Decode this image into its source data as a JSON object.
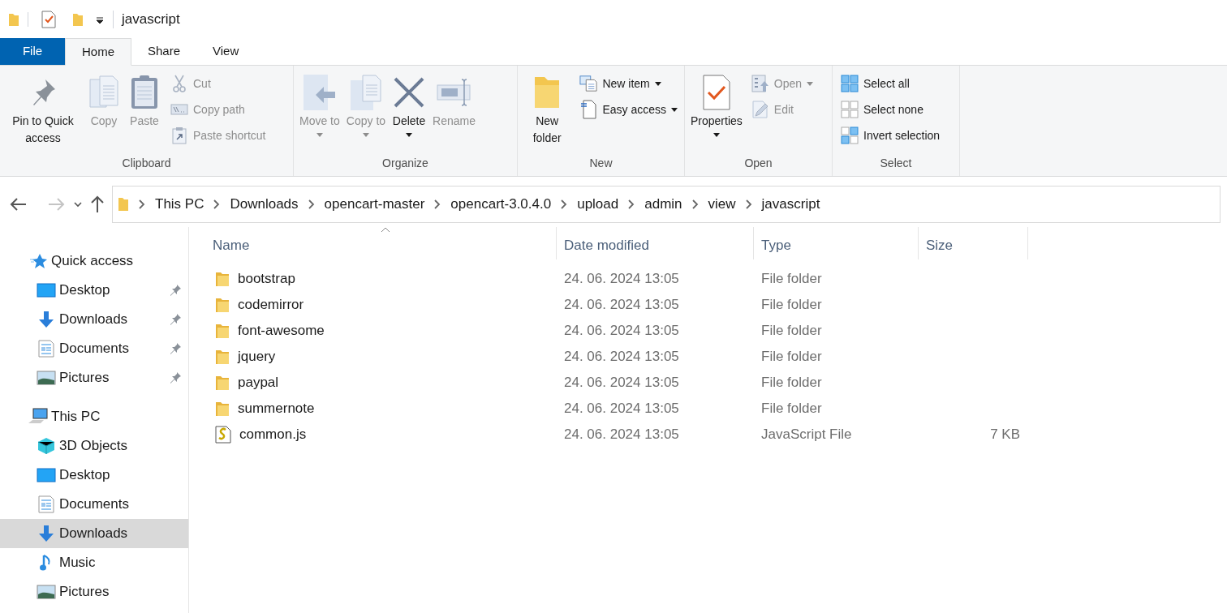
{
  "window": {
    "title": "javascript"
  },
  "tabs": [
    {
      "label": "File",
      "selected": false,
      "kind": "file"
    },
    {
      "label": "Home",
      "selected": true,
      "kind": "tab"
    },
    {
      "label": "Share",
      "selected": false,
      "kind": "tab"
    },
    {
      "label": "View",
      "selected": false,
      "kind": "tab"
    }
  ],
  "ribbon": {
    "groups": [
      {
        "label": "Clipboard",
        "items": [
          {
            "label": "Pin to Quick access",
            "kind": "large",
            "disabled": false,
            "dropdown": false
          },
          {
            "label": "Copy",
            "kind": "large",
            "disabled": true,
            "dropdown": false
          },
          {
            "label": "Paste",
            "kind": "large",
            "disabled": true,
            "dropdown": false
          },
          {
            "label": "Cut",
            "kind": "small",
            "disabled": true,
            "dropdown": false
          },
          {
            "label": "Copy path",
            "kind": "small",
            "disabled": true,
            "dropdown": false
          },
          {
            "label": "Paste shortcut",
            "kind": "small",
            "disabled": true,
            "dropdown": false
          }
        ]
      },
      {
        "label": "Organize",
        "items": [
          {
            "label": "Move to",
            "kind": "large",
            "disabled": true,
            "dropdown": true
          },
          {
            "label": "Copy to",
            "kind": "large",
            "disabled": true,
            "dropdown": true
          },
          {
            "label": "Delete",
            "kind": "large",
            "disabled": false,
            "dropdown": true
          },
          {
            "label": "Rename",
            "kind": "large",
            "disabled": true,
            "dropdown": false
          }
        ]
      },
      {
        "label": "New",
        "items": [
          {
            "label": "New folder",
            "kind": "large",
            "disabled": false,
            "dropdown": false
          },
          {
            "label": "New item",
            "kind": "small",
            "disabled": false,
            "dropdown": true
          },
          {
            "label": "Easy access",
            "kind": "small",
            "disabled": false,
            "dropdown": true
          }
        ]
      },
      {
        "label": "Open",
        "items": [
          {
            "label": "Properties",
            "kind": "large",
            "disabled": false,
            "dropdown": true
          },
          {
            "label": "Open",
            "kind": "small",
            "disabled": true,
            "dropdown": true
          },
          {
            "label": "Edit",
            "kind": "small",
            "disabled": true,
            "dropdown": false
          }
        ]
      },
      {
        "label": "Select",
        "items": [
          {
            "label": "Select all",
            "kind": "small",
            "disabled": false,
            "dropdown": false
          },
          {
            "label": "Select none",
            "kind": "small",
            "disabled": false,
            "dropdown": false
          },
          {
            "label": "Invert selection",
            "kind": "small",
            "disabled": false,
            "dropdown": false
          }
        ]
      }
    ]
  },
  "navigation": {
    "forward_disabled": true,
    "breadcrumb": [
      "This PC",
      "Downloads",
      "opencart-master",
      "opencart-3.0.4.0",
      "upload",
      "admin",
      "view",
      "javascript"
    ]
  },
  "sidebar": {
    "items": [
      {
        "label": "Quick access",
        "kind": "header",
        "pinned": false,
        "selected": false
      },
      {
        "label": "Desktop",
        "kind": "item",
        "pinned": true,
        "selected": false
      },
      {
        "label": "Downloads",
        "kind": "item",
        "pinned": true,
        "selected": false
      },
      {
        "label": "Documents",
        "kind": "item",
        "pinned": true,
        "selected": false
      },
      {
        "label": "Pictures",
        "kind": "item",
        "pinned": true,
        "selected": false
      },
      {
        "label": "This PC",
        "kind": "header",
        "pinned": false,
        "selected": false
      },
      {
        "label": "3D Objects",
        "kind": "item",
        "pinned": false,
        "selected": false
      },
      {
        "label": "Desktop",
        "kind": "item",
        "pinned": false,
        "selected": false
      },
      {
        "label": "Documents",
        "kind": "item",
        "pinned": false,
        "selected": false
      },
      {
        "label": "Downloads",
        "kind": "item",
        "pinned": false,
        "selected": true
      },
      {
        "label": "Music",
        "kind": "item",
        "pinned": false,
        "selected": false
      },
      {
        "label": "Pictures",
        "kind": "item",
        "pinned": false,
        "selected": false
      }
    ]
  },
  "table": {
    "columns": [
      {
        "label": "Name",
        "sorted": true
      },
      {
        "label": "Date modified",
        "sorted": false
      },
      {
        "label": "Type",
        "sorted": false
      },
      {
        "label": "Size",
        "sorted": false
      }
    ],
    "rows": [
      {
        "kind": "folder",
        "name": "bootstrap",
        "date": "24. 06. 2024 13:05",
        "type": "File folder"
      },
      {
        "kind": "folder",
        "name": "codemirror",
        "date": "24. 06. 2024 13:05",
        "type": "File folder"
      },
      {
        "kind": "folder",
        "name": "font-awesome",
        "date": "24. 06. 2024 13:05",
        "type": "File folder"
      },
      {
        "kind": "folder",
        "name": "jquery",
        "date": "24. 06. 2024 13:05",
        "type": "File folder"
      },
      {
        "kind": "folder",
        "name": "paypal",
        "date": "24. 06. 2024 13:05",
        "type": "File folder"
      },
      {
        "kind": "folder",
        "name": "summernote",
        "date": "24. 06. 2024 13:05",
        "type": "File folder"
      },
      {
        "kind": "js",
        "name": "common.js",
        "date": "24. 06. 2024 13:05",
        "type": "JavaScript File",
        "size": "7 KB"
      }
    ]
  }
}
